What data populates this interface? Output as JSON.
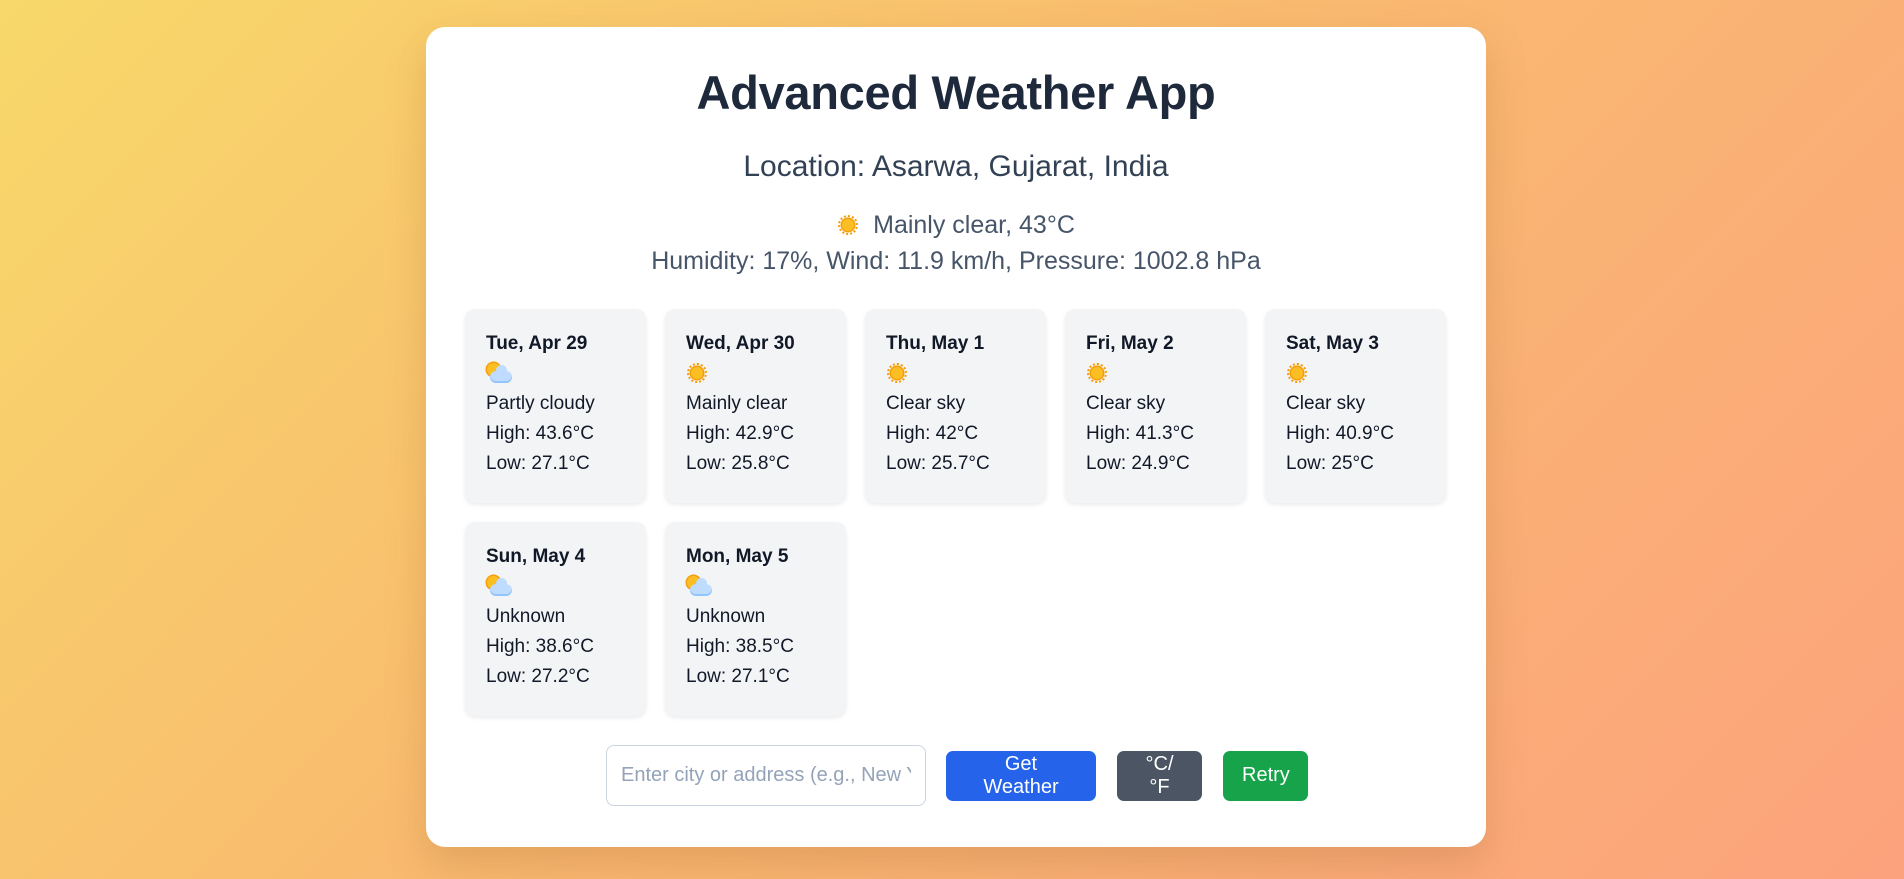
{
  "app": {
    "title": "Advanced Weather App",
    "location_text": "Location: Asarwa, Gujarat, India"
  },
  "current": {
    "icon": "sun-icon",
    "summary": "Mainly clear, 43°C",
    "details": "Humidity: 17%, Wind: 11.9 km/h, Pressure: 1002.8 hPa"
  },
  "forecast": [
    {
      "date": "Tue, Apr 29",
      "icon": "partly-cloudy-icon",
      "condition": "Partly cloudy",
      "high": "High: 43.6°C",
      "low": "Low: 27.1°C"
    },
    {
      "date": "Wed, Apr 30",
      "icon": "sun-icon",
      "condition": "Mainly clear",
      "high": "High: 42.9°C",
      "low": "Low: 25.8°C"
    },
    {
      "date": "Thu, May 1",
      "icon": "sun-icon",
      "condition": "Clear sky",
      "high": "High: 42°C",
      "low": "Low: 25.7°C"
    },
    {
      "date": "Fri, May 2",
      "icon": "sun-icon",
      "condition": "Clear sky",
      "high": "High: 41.3°C",
      "low": "Low: 24.9°C"
    },
    {
      "date": "Sat, May 3",
      "icon": "sun-icon",
      "condition": "Clear sky",
      "high": "High: 40.9°C",
      "low": "Low: 25°C"
    },
    {
      "date": "Sun, May 4",
      "icon": "partly-cloudy-icon",
      "condition": "Unknown",
      "high": "High: 38.6°C",
      "low": "Low: 27.2°C"
    },
    {
      "date": "Mon, May 5",
      "icon": "partly-cloudy-icon",
      "condition": "Unknown",
      "high": "High: 38.5°C",
      "low": "Low: 27.1°C"
    }
  ],
  "controls": {
    "search_placeholder": "Enter city or address (e.g., New York)",
    "search_value": "",
    "get_weather_label": "Get Weather",
    "unit_toggle_label": "°C/°F",
    "retry_label": "Retry"
  },
  "colors": {
    "get_weather": "#2563eb",
    "unit_toggle": "#4b5563",
    "retry": "#16a34a"
  }
}
